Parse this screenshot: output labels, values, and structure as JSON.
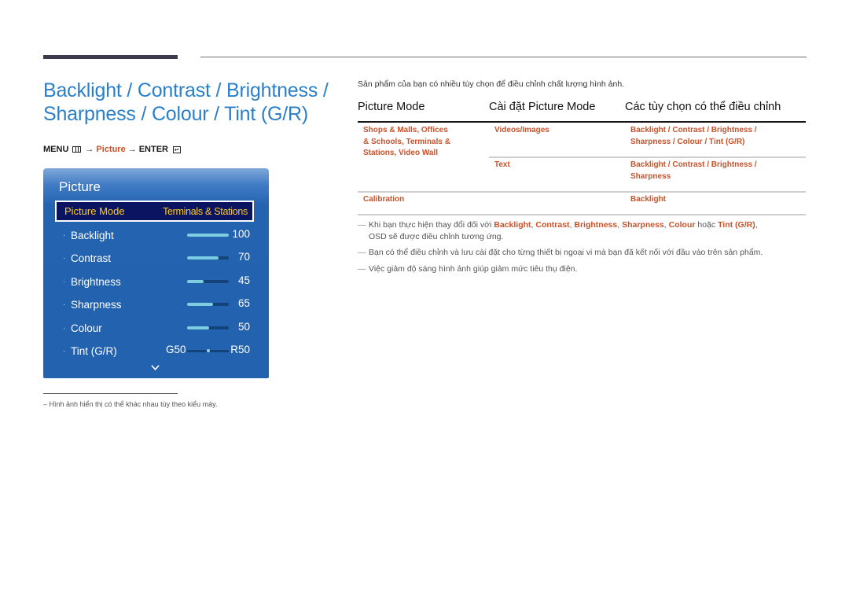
{
  "page": {
    "title_line1": "Backlight / Contrast / Brightness /",
    "title_line2": "Sharpness / Colour / Tint (G/R)",
    "menu_path": {
      "menu": "MENU",
      "arrow1": "→",
      "picture": "Picture",
      "arrow2": "→",
      "enter": "ENTER",
      "enter_icon": "↵"
    },
    "footnote": "–  Hình ảnh hiển thị có thể khác nhau tùy theo kiểu máy."
  },
  "osd": {
    "title": "Picture",
    "selected": {
      "label": "Picture Mode",
      "value": "Terminals & Stations"
    },
    "rows": [
      {
        "label": "Backlight",
        "value": "100",
        "fill": 1.0
      },
      {
        "label": "Contrast",
        "value": "70",
        "fill": 0.75
      },
      {
        "label": "Brightness",
        "value": "45",
        "fill": 0.4
      },
      {
        "label": "Sharpness",
        "value": "65",
        "fill": 0.62
      },
      {
        "label": "Colour",
        "value": "50",
        "fill": 0.53
      }
    ],
    "tint": {
      "label": "Tint (G/R)",
      "g": "G50",
      "r": "R50",
      "position": 0.5
    },
    "bullet_glyph": "·"
  },
  "content": {
    "intro": "Sản phẩm của bạn có nhiều tùy chọn để điều chỉnh chất lượng hình ảnh.",
    "table": {
      "headers": [
        "Picture Mode",
        "Cài đặt Picture Mode",
        "Các tùy chọn có thể điều chỉnh"
      ],
      "mode_group": [
        "Shops & Malls, Offices",
        "& Schools, Terminals &",
        "Stations, Video Wall"
      ],
      "rows": [
        {
          "setting": "Videos/Images",
          "options_line1": "Backlight / Contrast / Brightness /",
          "options_line2": "Sharpness / Colour / Tint (G/R)"
        },
        {
          "setting": "Text",
          "options_line1": "Backlight / Contrast / Brightness /",
          "options_line2": "Sharpness"
        },
        {
          "mode": "Calibration",
          "setting": "",
          "options_line1": "Backlight"
        }
      ]
    },
    "notes": [
      {
        "pre": "Khi bạn thực hiện thay đổi đối với ",
        "b1": "Backlight",
        "s1": ", ",
        "b2": "Contrast",
        "s2": ", ",
        "b3": "Brightness",
        "s3": ", ",
        "b4": "Sharpness",
        "s4": ", ",
        "b5": "Colour",
        "s5": " hoặc ",
        "b6": "Tint (G/R)",
        "post": ",",
        "line2": "OSD sẽ được điều chỉnh tương ứng."
      },
      {
        "text": "Bạn có thể điều chỉnh và lưu cài đặt cho từng thiết bị ngoại vi mà bạn đã kết nối với đầu vào trên sản phẩm."
      },
      {
        "text": "Việc giảm độ sáng hình ảnh giúp giảm mức tiêu thụ điện."
      }
    ],
    "note_dash": "—"
  },
  "colors": {
    "accent_blue": "#2a7fc8",
    "accent_orange": "#c8522a",
    "osd_blue": "#2262ae",
    "osd_highlight": "#ffcc22"
  }
}
